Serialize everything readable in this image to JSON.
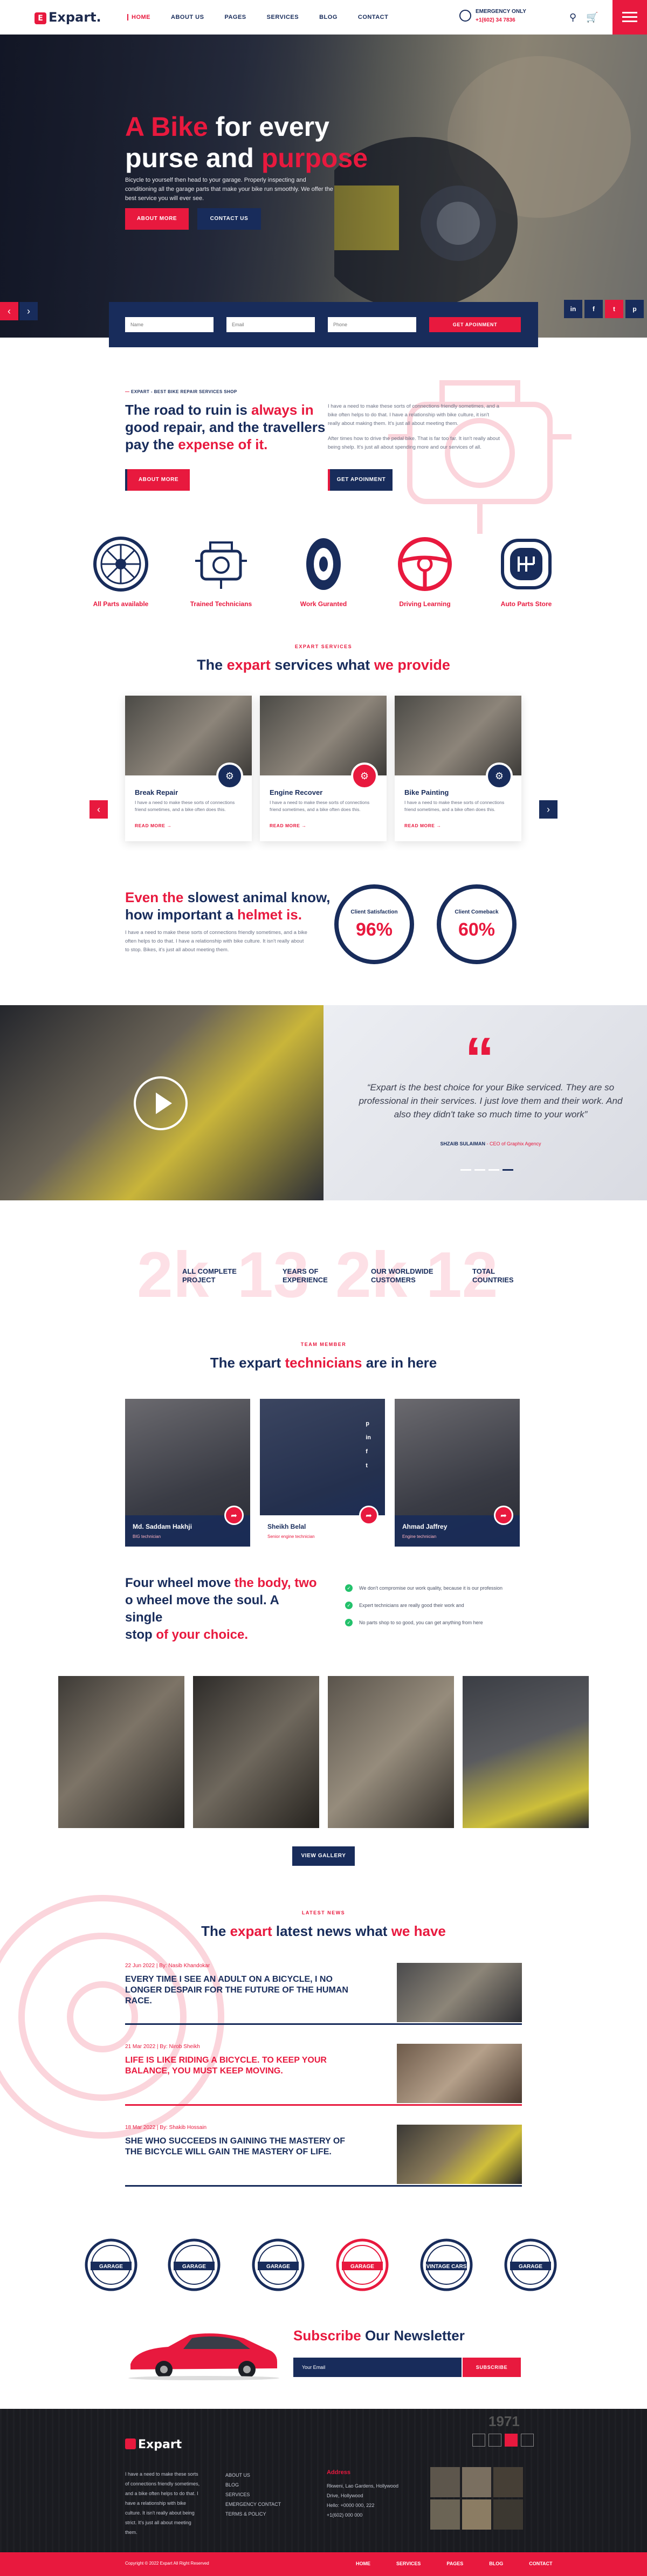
{
  "header": {
    "logo_text": "Expart.",
    "logo_mark": "E",
    "nav": [
      "HOME",
      "ABOUT US",
      "PAGES",
      "SERVICES",
      "BLOG",
      "CONTACT"
    ],
    "emergency_label": "EMERGENCY ONLY",
    "emergency_phone": "+1(602) 34 7836"
  },
  "hero": {
    "title_accent": "A Bike",
    "title_rest1": " for every",
    "title_line2": "purse and ",
    "title_accent2": "purpose",
    "text": "Bicycle to yourself then head to your garage. Properly inspecting and conditioning all the garage parts that make your bike run smoothly. We offer the best service you will ever see.",
    "btn_more": "ABOUT MORE",
    "btn_contact": "CONTACT US"
  },
  "appointment": {
    "name_ph": "Name",
    "email_ph": "Email",
    "phone_ph": "Phone",
    "submit": "GET APOINMENT"
  },
  "social": [
    "in",
    "f",
    "t",
    "p"
  ],
  "about": {
    "eyebrow": "EXPART - BEST BIKE REPAIR SERVICES SHOP",
    "h_line1": "The road to ruin is ",
    "h_accent1": "always in",
    "h_line2": "good repair, and the travellers",
    "h_line3": "pay the ",
    "h_accent2": "expense of it.",
    "btn": "ABOUT MORE",
    "p1": "I have a need to make these sorts of connections friendly sometimes, and a bike often helps to do that. I have a relationship with bike culture, it isn't really about making them. It's just all about meeting them.",
    "p2": "After times how to drive the pedal bike. That is far too far. It isn't really about being shelp. It's just all about spending more and our services of all.",
    "btn2": "GET APOINMENT"
  },
  "features": [
    {
      "icon": "wheel-icon",
      "label": "All Parts available"
    },
    {
      "icon": "engine-icon",
      "label": "Trained Technicians"
    },
    {
      "icon": "tire-icon",
      "label": "Work Guranted"
    },
    {
      "icon": "steering-icon",
      "label": "Driving Learning"
    },
    {
      "icon": "gear-shift-icon",
      "label": "Auto Parts Store"
    }
  ],
  "services": {
    "eyebrow": "EXPART SERVICES",
    "h_pre": "The ",
    "h_accent1": "expart",
    "h_mid": " services what ",
    "h_accent2": "we provide",
    "cards": [
      {
        "title": "Break Repair",
        "desc": "I have a need to make these sorts of connections friend sometimes, and a bike often does this.",
        "more": "READ MORE",
        "icon": "brake-icon"
      },
      {
        "title": "Engine Recover",
        "desc": "I have a need to make these sorts of connections friend sometimes, and a bike often does this.",
        "more": "READ MORE",
        "icon": "engine-icon"
      },
      {
        "title": "Bike Painting",
        "desc": "I have a need to make these sorts of connections friend sometimes, and a bike often does this.",
        "more": "READ MORE",
        "icon": "paint-icon"
      }
    ]
  },
  "helmet": {
    "h_accent1": "Even the",
    "h_rest1": " slowest animal know,",
    "h_line2": "how important a ",
    "h_accent2": "helmet is.",
    "p": "I have a need to make these sorts of connections friendly sometimes, and a bike often helps to do that. I have a relationship with bike culture. It isn't really about to stop. Bikes, it's just all about meeting them.",
    "c1_label": "Client Satisfaction",
    "c1_value": "96%",
    "c1_fraction": 0.96,
    "c2_label": "Client Comeback",
    "c2_value": "60%",
    "c2_fraction": 0.6
  },
  "testimonial": {
    "quote": "“Expart is the best choice for your Bike serviced. They are so professional in their services. I just love them and their work. And also they didn't take so much time to your work”",
    "author": "SHZAIB SULAIMAN",
    "role": " - CEO of Graphix Agency"
  },
  "stats": [
    {
      "big": "2k",
      "label1": "ALL COMPLETE",
      "label2": "PROJECT"
    },
    {
      "big": "13",
      "label1": "YEARS OF",
      "label2": "EXPERIENCE"
    },
    {
      "big": "2k",
      "label1": "OUR WORLDWIDE",
      "label2": "CUSTOMERS"
    },
    {
      "big": "12",
      "label1": "TOTAL",
      "label2": "COUNTRIES"
    }
  ],
  "team": {
    "eyebrow": "TEAM MEMBER",
    "h_pre": "The expart ",
    "h_accent": "technicians",
    "h_post": " are in here",
    "members": [
      {
        "name": "Md. Saddam Hakhji",
        "role": "BIG technician"
      },
      {
        "name": "Sheikh Belal",
        "role": "Senior engine technician"
      },
      {
        "name": "Ahmad Jaffrey",
        "role": "Engine technician"
      }
    ]
  },
  "wheel": {
    "h_line1": "Four wheel move ",
    "h_accent1": "the body, two",
    "h_line2": "o wheel move the soul. A single",
    "h_line3": "stop ",
    "h_accent2": "of your choice.",
    "checks": [
      "We don't compromise our work quality, because it is our profession",
      "Expert technicians are really good their work and",
      "No parts shop to so good, you can get anything from here"
    ]
  },
  "gallery": {
    "btn": "VIEW GALLERY"
  },
  "news": {
    "eyebrow": "LATEST NEWS",
    "h_pre": "The ",
    "h_accent1": "expart",
    "h_mid": " latest news what ",
    "h_accent2": "we have",
    "items": [
      {
        "date": "22 Jun 2022 | By: Nasib Khandokar",
        "title": "EVERY TIME I SEE AN ADULT ON A BICYCLE, I NO LONGER DESPAIR FOR THE FUTURE OF THE HUMAN RACE."
      },
      {
        "date": "21 Mar 2022 | By: Nirob Sheikh",
        "title": "LIFE IS LIKE RIDING A BICYCLE. TO KEEP YOUR BALANCE, YOU MUST KEEP MOVING."
      },
      {
        "date": "18 Mar 2022 | By: Shakib Hossain",
        "title": "SHE WHO SUCCEEDS IN GAINING THE MASTERY OF THE BICYCLE WILL GAIN THE MASTERY OF LIFE."
      }
    ]
  },
  "brands": [
    "GARAGE",
    "GARAGE",
    "GARAGE",
    "GARAGE",
    "VINTAGE CARS",
    "GARAGE"
  ],
  "newsletter": {
    "h_accent": "Subscribe",
    "h_rest": " Our Newsletter",
    "email_ph": "Your Email",
    "btn": "SUBSCRIBE"
  },
  "footer": {
    "logo": "Expart",
    "about": "I have a need to make these sorts of connections friendly sometimes, and a bike often helps to do that. I have a relationship with bike culture. It isn't really about being strict. It's just all about meeting them.",
    "links": [
      "ABOUT US",
      "BLOG",
      "SERVICES",
      "EMERGENCY CONTACT",
      "TERMS & POLICY"
    ],
    "contact_head": "Address",
    "contact": [
      "Rkweni, Lao Gardens, Hollywood",
      "Drive, Hollywood",
      "Hello: +0000 000, 222",
      "+1(602) 000 000"
    ],
    "year": "1971",
    "copyright": "Copyright © 2022 Expart All Right Reserved",
    "bottom_nav": [
      "HOME",
      "SERVICES",
      "PAGES",
      "BLOG",
      "CONTACT"
    ]
  }
}
